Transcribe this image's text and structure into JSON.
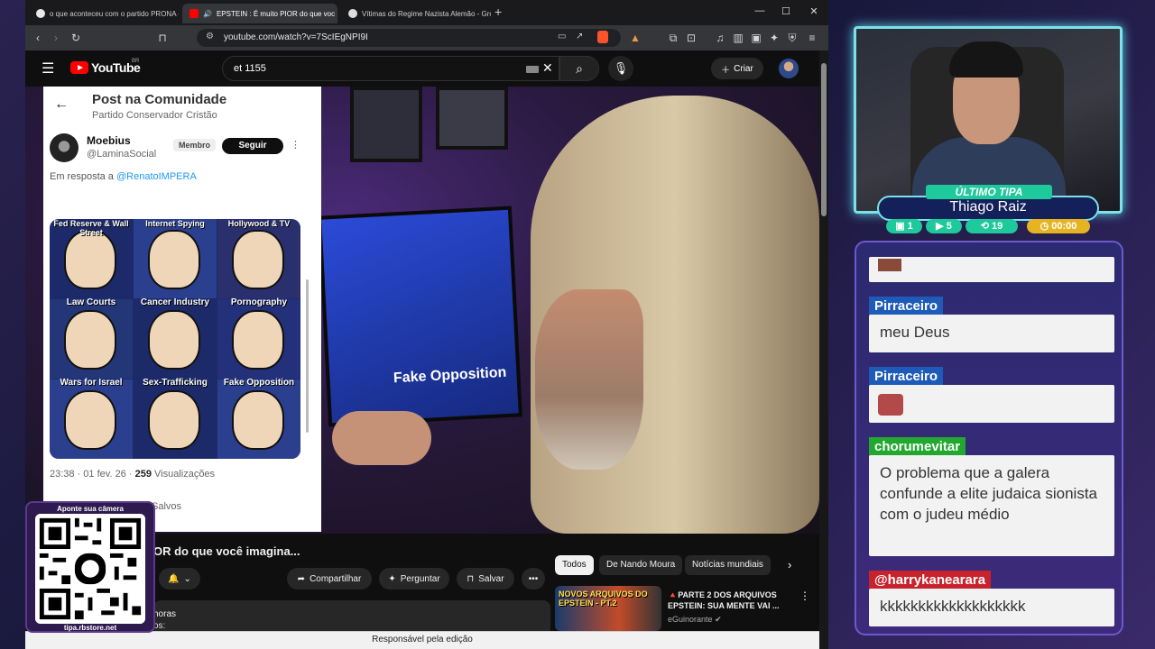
{
  "browser": {
    "tabs": [
      {
        "title": "o que aconteceu com o partido PRONA - Pe"
      },
      {
        "title": "EPSTEIN : É muito PIOR do que voc"
      },
      {
        "title": "Vítimas do Regime Nazista Alemão - Grok"
      }
    ],
    "url": "youtube.com/watch?v=7ScIEgNPI9I"
  },
  "youtube": {
    "logo_text": "YouTube",
    "region": "BR",
    "search_value": "et 1155",
    "create_label": "Criar"
  },
  "video": {
    "monitor_text": "Fake Opposition"
  },
  "community_post": {
    "header_title": "Post na Comunidade",
    "header_channel": "Partido Conservador Cristão",
    "author_name": "Moebius",
    "author_handle": "@LaminaSocial",
    "badge": "Membro",
    "follow_label": "Seguir",
    "reply_prefix": "Em resposta a ",
    "reply_mention": "@RenatoIMPERA",
    "image_captions": {
      "fed": "Fed Reserve & Wall Street",
      "internet": "Internet Spying",
      "hollywood": "Hollywood & TV",
      "law": "Law Courts",
      "cancer": "Cancer Industry",
      "porn": "Pornography",
      "wars": "Wars for Israel",
      "sex": "Sex-Trafficking",
      "fake": "Fake Opposition"
    },
    "stats_time": "23:38 · 01 fev. 26 · ",
    "stats_views": "259",
    "stats_suffix": " Visualizações",
    "saved_label": "Salvos"
  },
  "below_video": {
    "title": "OR do que você imagina...",
    "share_label": "Compartilhar",
    "ask_label": "Perguntar",
    "save_label": "Salvar",
    "desc_time": "horas",
    "desc_line2": "os:",
    "chips": [
      "Todos",
      "De Nando Moura",
      "Notícias mundiais"
    ],
    "recommended": {
      "thumb_text": "NOVOS ARQUIVOS DO EPSTEIN - PT.2",
      "title": "🔺PARTE 2 DOS ARQUIVOS EPSTEIN: SUA MENTE VAI ...",
      "channel": "eGuinorante"
    }
  },
  "status_bar": "Responsável pela edição",
  "qr": {
    "top_text": "Aponte sua câmera",
    "bottom_text": "tipa.rbstore.net"
  },
  "stream_overlay": {
    "label": "ÚLTIMO TIPA",
    "name": "Thiago Raiz",
    "stats": {
      "chat": "1",
      "video": "5",
      "shares": "19",
      "timer": "00:00"
    },
    "colors": {
      "accent": "#7ee0e8",
      "green": "#1ec99b",
      "blue": "#1e5bb8",
      "red": "#c8232c",
      "gold": "#e6b422"
    }
  },
  "chat": {
    "messages": [
      {
        "user": "Pirraceiro",
        "text": "meu Deus"
      },
      {
        "user": "Pirraceiro",
        "text": ""
      },
      {
        "user": "chorumevitar",
        "text": "O problema que a galera confunde a elite judaica sionista com o judeu médio"
      },
      {
        "user": "@harrykanearara",
        "text": "kkkkkkkkkkkkkkkkkkk"
      }
    ]
  }
}
